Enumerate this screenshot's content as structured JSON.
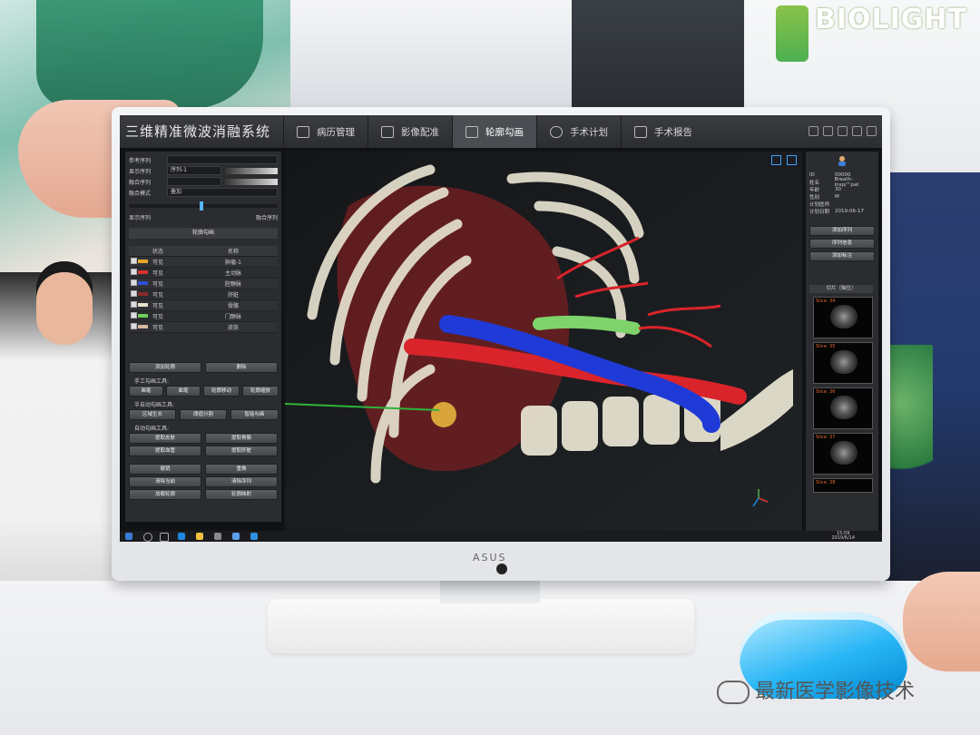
{
  "background": {
    "brand": "BIOLIGHT",
    "watermark": "最新医学影像技术",
    "monitor_logo": "ASUS"
  },
  "app": {
    "title": "三维精准微波消融系统",
    "tabs": [
      {
        "label": "病历管理",
        "icon": "folder-icon",
        "active": false
      },
      {
        "label": "影像配准",
        "icon": "image-register-icon",
        "active": false
      },
      {
        "label": "轮廓勾画",
        "icon": "contour-icon",
        "active": true
      },
      {
        "label": "手术计划",
        "icon": "crosshair-icon",
        "active": false
      },
      {
        "label": "手术报告",
        "icon": "report-icon",
        "active": false
      }
    ]
  },
  "left_panel": {
    "ref_label": "参考序列",
    "disp_label": "显示序列",
    "disp_value": "序列-1",
    "fuse_label": "融合序列",
    "mode_label": "融合模式",
    "mode_value": "叠加",
    "show_left": "显示序列",
    "show_right": "融合序列",
    "contour_header": "轮廓勾画",
    "table_headers": [
      "状态",
      "名称"
    ],
    "layers": [
      {
        "status": "可见",
        "name": "肿瘤-1",
        "color": "#e7a82e"
      },
      {
        "status": "可见",
        "name": "主动脉",
        "color": "#d9322b"
      },
      {
        "status": "可见",
        "name": "腔静脉",
        "color": "#2f4fd8"
      },
      {
        "status": "可见",
        "name": "肝脏",
        "color": "#8a2b2b"
      },
      {
        "status": "可见",
        "name": "骨骼",
        "color": "#e9e2c9"
      },
      {
        "status": "可见",
        "name": "门静脉",
        "color": "#6fcf5a"
      },
      {
        "status": "可见",
        "name": "皮肤",
        "color": "#d8b9a0"
      }
    ],
    "buttons": {
      "add_contour": "添加轮廓",
      "delete": "删除",
      "manual_tools": "手工勾画工具:",
      "brush": "画笔",
      "eraser": "曲笔",
      "contour_move": "轮廓移动",
      "contour_scale": "轮廓缩放",
      "semi_auto_tools": "半自动勾画工具:",
      "region_grow": "区域生长",
      "threshold_seg": "阈值分割",
      "smart_contour": "智能勾画",
      "auto_tools": "自动勾画工具:",
      "extract_skin": "提取皮肤",
      "extract_bone": "提取骨骼",
      "extract_vessel": "提取血管",
      "extract_liver": "提取肝脏",
      "undo": "撤销",
      "redo": "重做",
      "clear_current": "清除当前",
      "clear_sequence": "清除序列",
      "load_contour": "加载轮廓",
      "contour_map": "轮廓映射"
    }
  },
  "right_panel": {
    "info": [
      {
        "k": "ID",
        "v": "00000"
      },
      {
        "k": "姓名",
        "v": "Breath-insp/^pat"
      },
      {
        "k": "年龄",
        "v": "30"
      },
      {
        "k": "性别",
        "v": "M"
      },
      {
        "k": "计划医师",
        "v": ""
      },
      {
        "k": "计划日期",
        "v": "2019-06-17"
      }
    ],
    "btn_add_seq": "添加序列",
    "btn_seq_info": "序列信息",
    "btn_add_marker": "添加标注",
    "slice_header": "切片（轴位）",
    "slices": [
      "Slice: 34",
      "Slice: 35",
      "Slice: 36",
      "Slice: 37",
      "Slice: 38"
    ]
  },
  "taskbar": {
    "time": "15:09",
    "date": "2019/6/14"
  },
  "colors": {
    "bone": "#e6e1cf",
    "liver": "#7a1f22",
    "artery": "#d8242a",
    "vein": "#1f3ad6",
    "portal": "#7ed36a",
    "tumor": "#d9a43a",
    "needle": "#2fb43c"
  }
}
